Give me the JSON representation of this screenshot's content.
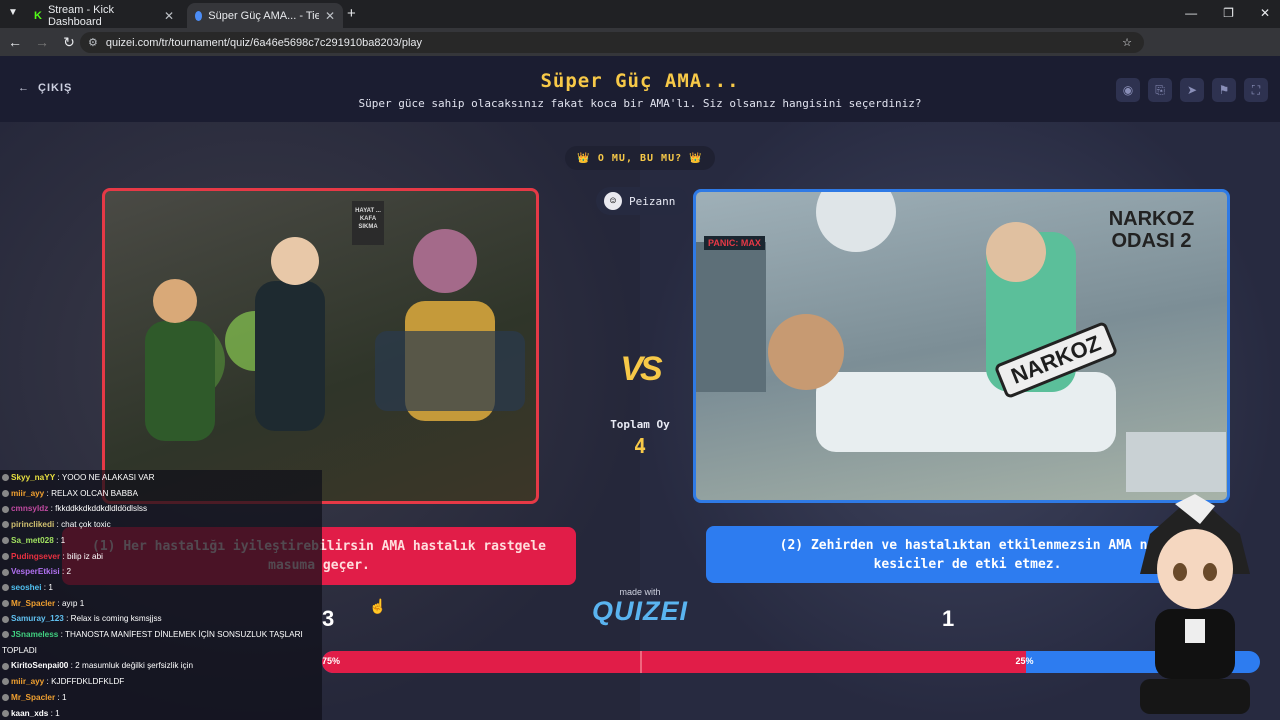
{
  "browser": {
    "tabs": [
      {
        "title": "Stream - Kick Dashboard",
        "active": false,
        "icon": "kick-icon"
      },
      {
        "title": "Süper Güç AMA... - Tier List, Kı",
        "active": true,
        "icon": "quizei-icon"
      }
    ],
    "new_tab": "+",
    "url": "quizei.com/tr/tournament/quiz/6a46e5698c7c291910ba8203/play",
    "window_controls": [
      "—",
      "❐",
      "✕"
    ]
  },
  "header": {
    "exit_label": "ÇIKIŞ",
    "title": "Süper Güç AMA...",
    "subtitle": "Süper güce sahip olacaksınız fakat koca bir AMA'lı. Siz olsanız hangisini seçerdiniz?",
    "tool_icons": [
      "eye-icon",
      "share-icon",
      "send-icon",
      "flag-icon",
      "fullscreen-icon"
    ]
  },
  "matchup": {
    "badge": "👑 O MU, BU MU? 👑",
    "player": "Peizann",
    "vs_label": "VS",
    "total_label": "Toplam Oy",
    "total_value": "4"
  },
  "left_option": {
    "image_sign": "HAYAT ... KAFA SIKMA",
    "text": "(1) Her hastalığı iyileştirebilirsin AMA hastalık rastgele masuma geçer.",
    "votes": "3",
    "percent": "75%",
    "share": 0.75
  },
  "right_option": {
    "image_title": "NARKOZ ODASI 2",
    "image_syringe": "NARKOZ",
    "image_panel": "PANIC: MAX",
    "text": "(2) Zehirden ve hastalıktan etkilenmezsin AMA narkoz/ağrı kesiciler de etki etmez.",
    "text_display": "(2) Zehirden ve hastalıktan etkilenmezsin AMA na",
    "text_display_2": "kesiciler de etki etmez.",
    "votes": "1",
    "percent": "25%",
    "share": 0.25
  },
  "branding": {
    "made_with": "made with",
    "logo": "QUIZEI"
  },
  "chat": [
    {
      "user": "Skyy_naYY",
      "text": "YOOO NE ALAKASI VAR",
      "color": "#e8e040"
    },
    {
      "user": "miir_ayy",
      "text": "RELAX OLCAN BABBA",
      "color": "#f0a030"
    },
    {
      "user": "cmnsyldz",
      "text": "fkkddkkdkddkdldldödlslss",
      "color": "#c04aa0"
    },
    {
      "user": "pirinclikedi",
      "text": "chat çok toxic",
      "color": "#d0c070"
    },
    {
      "user": "Sa_met028",
      "text": "1",
      "color": "#a0e060"
    },
    {
      "user": "Pudingsever",
      "text": "bilip iz abi",
      "color": "#e83040"
    },
    {
      "user": "VesperEtkisi",
      "text": "2",
      "color": "#b070f0"
    },
    {
      "user": "seoshei",
      "text": "1",
      "color": "#50c0f0"
    },
    {
      "user": "Mr_Spacler",
      "text": "ayıp 1",
      "color": "#f0a030"
    },
    {
      "user": "Samuray_123",
      "text": "Relax is coming ksmsjjss",
      "color": "#60c0f0"
    },
    {
      "user": "JSnameless",
      "text": "THANOSTA MANİFEST DİNLEMEK İÇİN SONSUZLUK TAŞLARI",
      "color": "#40d080"
    },
    {
      "user": "",
      "text": "TOPLADI",
      "color": "#ffffff"
    },
    {
      "user": "KiritoSenpai00",
      "text": "2 masumluk değilki şerfsizlik için",
      "color": "#ffffff"
    },
    {
      "user": "miir_ayy",
      "text": "KJDFFDKLDFKLDF",
      "color": "#f0a030"
    },
    {
      "user": "Mr_Spacler",
      "text": "1",
      "color": "#f0a030"
    },
    {
      "user": "kaan_xds",
      "text": "1",
      "color": "#ffffff"
    }
  ],
  "colors": {
    "accent": "#f7c948",
    "left": "#e11d48",
    "right": "#2d7cf0"
  }
}
